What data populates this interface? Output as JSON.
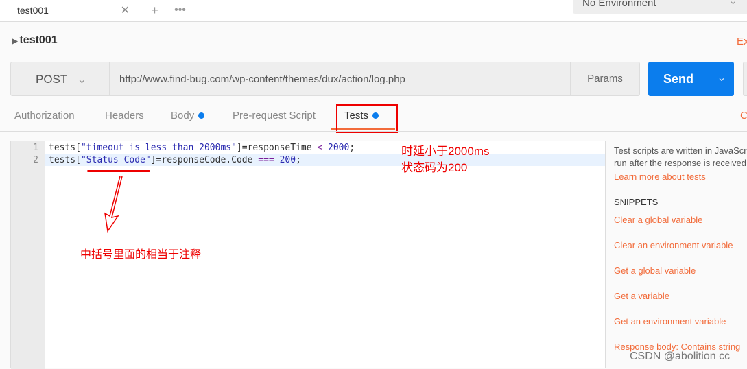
{
  "tabs": [
    {
      "label": "test001"
    }
  ],
  "environment": "No Environment",
  "request": {
    "name": "test001",
    "method": "POST",
    "url": "http://www.find-bug.com/wp-content/themes/dux/action/log.php",
    "params_label": "Params",
    "send_label": "Send",
    "examples_label": "Ex"
  },
  "request_tabs": [
    {
      "label": "Authorization"
    },
    {
      "label": "Headers"
    },
    {
      "label": "Body",
      "dot": true
    },
    {
      "label": "Pre-request Script"
    },
    {
      "label": "Tests",
      "dot": true,
      "active": true
    }
  ],
  "cookies_label": "C",
  "editor": {
    "lines": [
      {
        "no": "1"
      },
      {
        "no": "2"
      }
    ]
  },
  "side": {
    "desc1": "Test scripts are written in JavaScri",
    "desc2": "run after the response is received",
    "learn": "Learn more about tests",
    "snippets_title": "SNIPPETS",
    "snippets": [
      "Clear a global variable",
      "Clear an environment variable",
      "Get a global variable",
      "Get a variable",
      "Get an environment variable",
      "Response body: Contains string"
    ]
  },
  "annotations": {
    "note1": "时延小于2000ms",
    "note2": "状态码为200",
    "note3": "中括号里面的相当于注释"
  },
  "watermark": "CSDN @abolition cc",
  "colors": {
    "accent": "#0b7ded",
    "link": "#f26b3a",
    "annotation": "#ff0000"
  }
}
